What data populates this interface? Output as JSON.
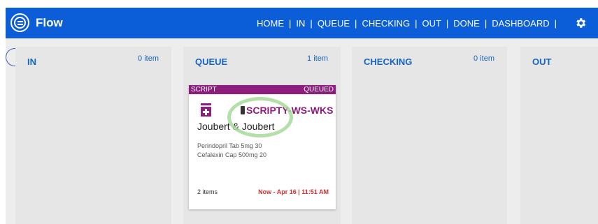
{
  "app": {
    "title": "Flow"
  },
  "nav": [
    "HOME",
    "IN",
    "QUEUE",
    "CHECKING",
    "OUT",
    "DONE",
    "DASHBOARD"
  ],
  "nav_sep": "|",
  "columns": [
    {
      "title": "IN",
      "count": "0 item"
    },
    {
      "title": "QUEUE",
      "count": "1 item"
    },
    {
      "title": "CHECKING",
      "count": "0 item"
    },
    {
      "title": "OUT",
      "count": ""
    }
  ],
  "card": {
    "type": "SCRIPT",
    "status": "QUEUED",
    "device": "SCRIPTY-WS-WKS",
    "customer": "Joubert & Joubert",
    "items": [
      "Perindopril Tab 5mg 30",
      "Cefalexin Cap 500mg 20"
    ],
    "item_count": "2 items",
    "time": "Now - Apr 16 | 11:51 AM"
  },
  "colors": {
    "topbar": "#0b5ed7",
    "accent": "#8e1e7e",
    "column_title": "#1565c0",
    "time": "#d32f2f"
  }
}
